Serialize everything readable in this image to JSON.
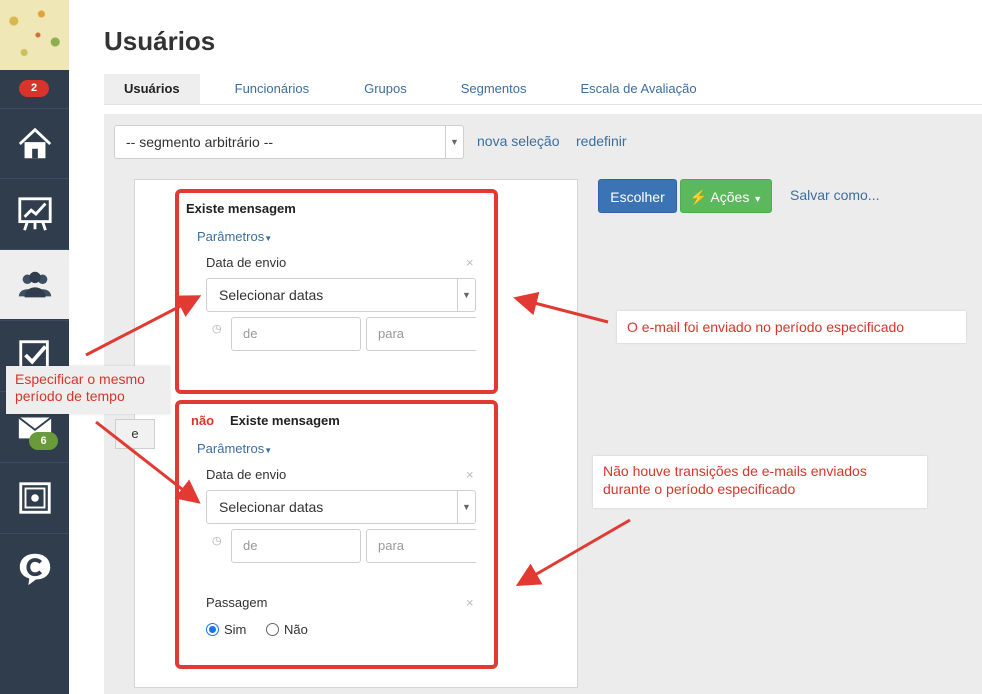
{
  "sidebar": {
    "notif_badge": "2",
    "mail_badge": "6",
    "items": [
      "home-icon",
      "presentation-chart-icon",
      "users-group-icon",
      "checkbox-icon",
      "mail-icon",
      "safe-icon",
      "chat-c-icon"
    ]
  },
  "page": {
    "title": "Usuários"
  },
  "tabs": [
    {
      "label": "Usuários",
      "active": true
    },
    {
      "label": "Funcionários"
    },
    {
      "label": "Grupos"
    },
    {
      "label": "Segmentos"
    },
    {
      "label": "Escala de Avaliação"
    }
  ],
  "segment": {
    "selected": "-- segmento arbitrário --",
    "new_selection": "nova seleção",
    "reset": "redefinir"
  },
  "actions": {
    "choose": "Escolher",
    "actions": "Ações",
    "save_as": "Salvar como..."
  },
  "condition1": {
    "title": "Existe mensagem",
    "params": "Parâmetros",
    "field_label": "Data de envio",
    "select": "Selecionar datas",
    "from_placeholder": "de",
    "to_placeholder": "para"
  },
  "connector": "e",
  "condition2": {
    "negation": "não",
    "title": "Existe mensagem",
    "params": "Parâmetros",
    "field_label": "Data de envio",
    "select": "Selecionar datas",
    "from_placeholder": "de",
    "to_placeholder": "para",
    "passage_label": "Passagem",
    "yes": "Sim",
    "no": "Não",
    "selected": "Sim"
  },
  "annotations": {
    "left_line1": "Especificar o mesmo",
    "left_line2": "período de tempo",
    "right1": "O e-mail foi enviado no período especificado",
    "right2_line1": "Não houve transições de e-mails enviados",
    "right2_line2": "durante o período especificado"
  },
  "colors": {
    "accent_red": "#e23a33",
    "link_blue": "#3d6e9e",
    "button_blue": "#3a74b5",
    "button_green": "#5cb85c",
    "sidebar": "#2f3d4d"
  }
}
